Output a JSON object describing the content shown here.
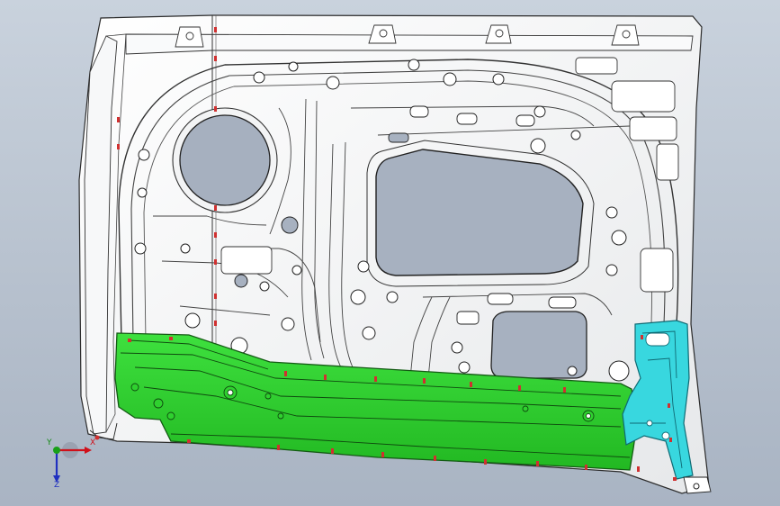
{
  "viewport": {
    "background_top": "#c9d2dd",
    "background_bottom": "#a9b4c3"
  },
  "model": {
    "panel_color": "#f4f5f6",
    "edge_color": "#2b2b2b",
    "highlight_part_color": "#2fd12f",
    "highlight_part_edge": "#1a6a1a",
    "secondary_part_color": "#38d7df",
    "secondary_part_edge": "#10707a",
    "marker_color": "#d03030"
  },
  "triad": {
    "x_label": "X",
    "y_label": "Y",
    "z_label": "Z",
    "x_color": "#d0101a",
    "y_color": "#138a13",
    "z_color": "#2030c0"
  }
}
